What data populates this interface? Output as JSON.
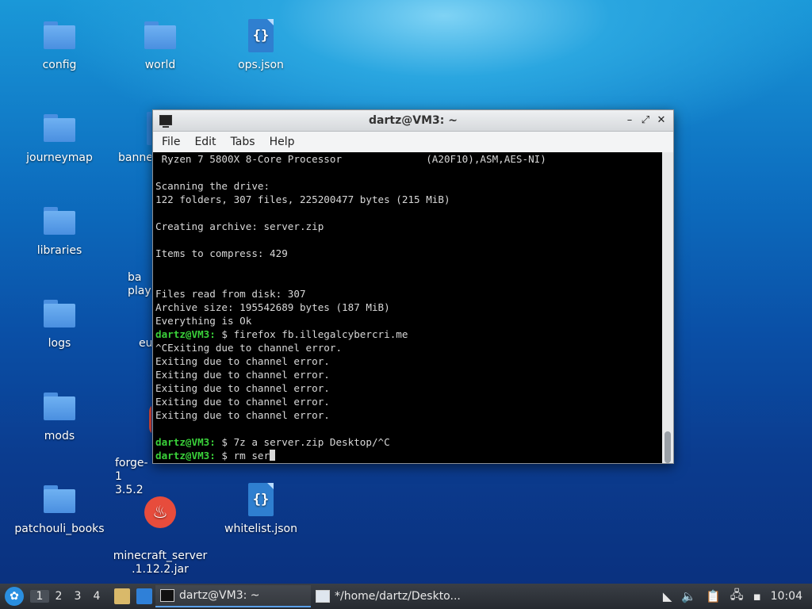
{
  "desktop": {
    "icons": [
      {
        "label": "config",
        "type": "folder"
      },
      {
        "label": "world",
        "type": "folder"
      },
      {
        "label": "ops.json",
        "type": "json"
      },
      {
        "label": "journeymap",
        "type": "folder"
      },
      {
        "label": "banne",
        "type": "partial"
      },
      {
        "label": "libraries",
        "type": "folder"
      },
      {
        "label": "ba\nplaye",
        "type": "partial"
      },
      {
        "label": "logs",
        "type": "folder"
      },
      {
        "label": "eu",
        "type": "partial"
      },
      {
        "label": "mods",
        "type": "folder"
      },
      {
        "label": "forge-1\n3.5.2",
        "type": "partial"
      },
      {
        "label": "patchouli_books",
        "type": "folder"
      },
      {
        "label": "minecraft_server\n.1.12.2.jar",
        "type": "java"
      },
      {
        "label": "whitelist.json",
        "type": "json"
      }
    ]
  },
  "terminal": {
    "title": "dartz@VM3: ~",
    "controls": {
      "minimize": "–",
      "maximize": "⤢",
      "close": "✕"
    },
    "menu": [
      "File",
      "Edit",
      "Tabs",
      "Help"
    ],
    "lines": [
      {
        "text": " Ryzen 7 5800X 8-Core Processor              (A20F10),ASM,AES-NI)"
      },
      {
        "text": ""
      },
      {
        "text": "Scanning the drive:"
      },
      {
        "text": "122 folders, 307 files, 225200477 bytes (215 MiB)"
      },
      {
        "text": ""
      },
      {
        "text": "Creating archive: server.zip"
      },
      {
        "text": ""
      },
      {
        "text": "Items to compress: 429"
      },
      {
        "text": ""
      },
      {
        "text": ""
      },
      {
        "text": "Files read from disk: 307"
      },
      {
        "text": "Archive size: 195542689 bytes (187 MiB)"
      },
      {
        "text": "Everything is Ok"
      },
      {
        "user": "dartz@VM3:",
        "text": " $ firefox fb.illegalcybercri.me"
      },
      {
        "text": "^CExiting due to channel error."
      },
      {
        "text": "Exiting due to channel error."
      },
      {
        "text": "Exiting due to channel error."
      },
      {
        "text": "Exiting due to channel error."
      },
      {
        "text": "Exiting due to channel error."
      },
      {
        "text": "Exiting due to channel error."
      },
      {
        "text": ""
      },
      {
        "user": "dartz@VM3:",
        "text": " $ 7z a server.zip Desktop/^C"
      },
      {
        "user": "dartz@VM3:",
        "text": " $ rm ser",
        "cursor": true
      }
    ]
  },
  "taskbar": {
    "start_icon": "start-menu-icon",
    "workspaces": [
      "1",
      "2",
      "3",
      "4"
    ],
    "tasks": [
      {
        "label": "dartz@VM3: ~",
        "icon": "terminal-icon"
      },
      {
        "label": "*/home/dartz/Deskto...",
        "icon": "text-editor-icon"
      }
    ],
    "tray": {
      "volume": "volume-icon",
      "clipboard": "clipboard-icon",
      "network": "network-icon",
      "battery": "battery-icon"
    },
    "clock": "10:04"
  }
}
